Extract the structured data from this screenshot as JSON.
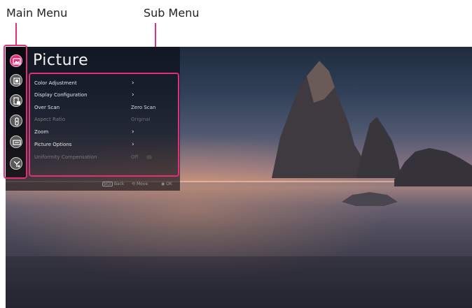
{
  "annotations": {
    "main_menu_label": "Main Menu",
    "sub_menu_label": "Sub Menu"
  },
  "panel": {
    "title": "Picture"
  },
  "main_menu": [
    {
      "icon": "picture-icon",
      "active": true
    },
    {
      "icon": "display-icon",
      "active": false
    },
    {
      "icon": "input-icon",
      "active": false
    },
    {
      "icon": "sound-icon",
      "active": false
    },
    {
      "icon": "network-icon",
      "active": false
    },
    {
      "icon": "settings-icon",
      "active": false
    }
  ],
  "sub_menu": {
    "items": [
      {
        "label": "Color Adjustment",
        "value": "›",
        "dim": false
      },
      {
        "label": "Display Configuration",
        "value": "›",
        "dim": false
      },
      {
        "label": "Over Scan",
        "value": "Zero Scan",
        "dim": false
      },
      {
        "label": "Aspect Ratio",
        "value": "Original",
        "dim": true
      },
      {
        "label": "Zoom",
        "value": "›",
        "dim": false
      },
      {
        "label": "Picture Options",
        "value": "›",
        "dim": false
      },
      {
        "label": "Uniformity Compensation",
        "value": "Off",
        "dim": true
      }
    ]
  },
  "hints": {
    "back_key": "BACK",
    "back": "Back",
    "move": "Move",
    "ok": "OK"
  },
  "colors": {
    "accent": "#e0307a",
    "panel_bg": "rgba(10,12,18,0.62)"
  }
}
